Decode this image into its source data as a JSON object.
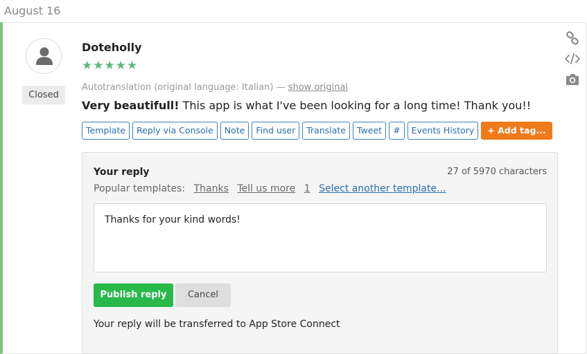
{
  "date_header": "August 16",
  "review": {
    "author": "Doteholly",
    "stars": "★★★★★",
    "status": "Closed",
    "autotranslation_text": "Autotranslation (original language: Italian) — ",
    "show_original": "show original",
    "title": "Very beautifull!",
    "body": " This app is what I've been looking for a long time! Thank you!!"
  },
  "actions": [
    "Template",
    "Reply via Console",
    "Note",
    "Find user",
    "Translate",
    "Tweet",
    "#",
    "Events History"
  ],
  "add_tag": "+ Add tag...",
  "tools": {
    "link_icon": "link-icon",
    "code_icon": "code-icon",
    "camera_icon": "camera-icon"
  },
  "reply": {
    "title": "Your reply",
    "char_count": "27 of 5970 characters",
    "popular_label": "Popular templates:",
    "templates": [
      "Thanks",
      "Tell us more",
      "1"
    ],
    "select_another": "Select another template...",
    "text": "Thanks for your kind words!",
    "publish_label": "Publish reply",
    "cancel_label": "Cancel",
    "transfer_note": "Your reply will be transferred to App Store Connect"
  },
  "colors": {
    "accent_green": "#7cc47f",
    "star_green": "#5cb87a",
    "link_blue": "#2b6db1",
    "add_tag_orange": "#ef7b1c",
    "publish_green": "#28b94a"
  }
}
